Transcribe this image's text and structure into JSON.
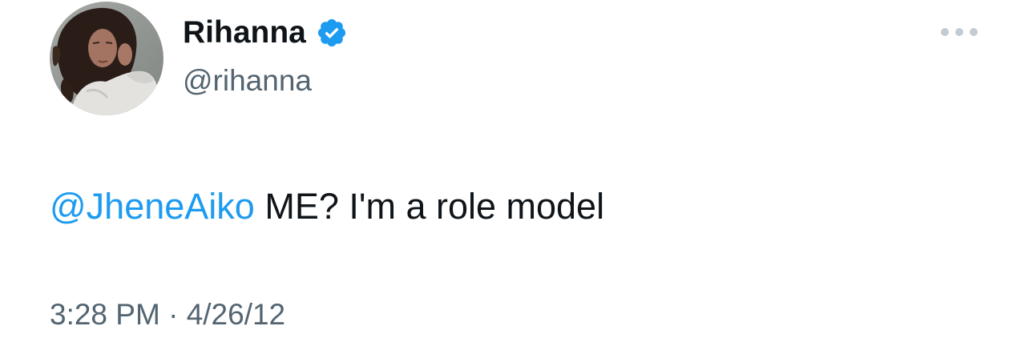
{
  "tweet": {
    "author": {
      "display_name": "Rihanna",
      "handle": "@rihanna",
      "verified": true,
      "avatar_icon": "profile-photo"
    },
    "more_icon": "ellipsis-icon",
    "text": {
      "mention": "@JheneAiko",
      "body": "ME? I'm a role model"
    },
    "time": "3:28 PM",
    "separator": "·",
    "date": "4/26/12",
    "colors": {
      "mention": "#1d9bf0",
      "verified_badge": "#1d9bf0",
      "secondary_text": "#536471",
      "primary_text": "#0f1419"
    }
  }
}
